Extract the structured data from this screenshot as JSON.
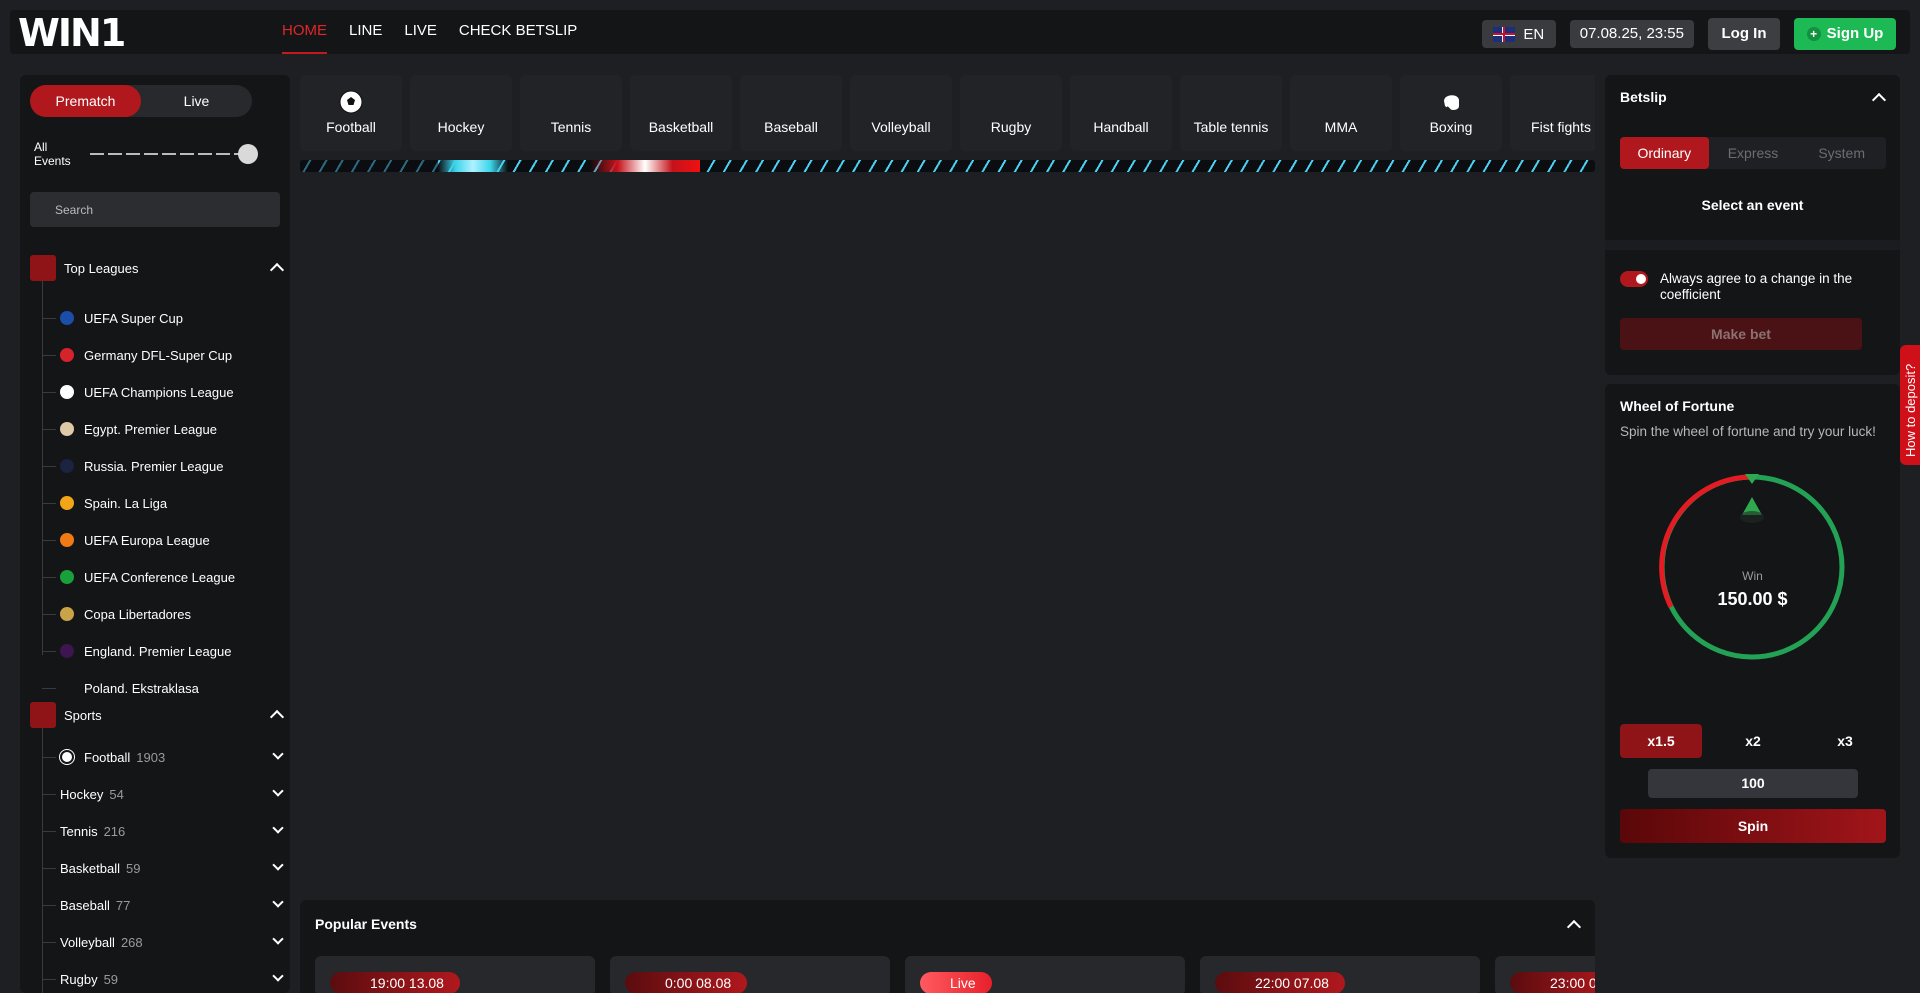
{
  "header": {
    "logo": "WIN1",
    "nav": [
      {
        "label": "HOME",
        "active": true
      },
      {
        "label": "LINE",
        "active": false
      },
      {
        "label": "LIVE",
        "active": false
      },
      {
        "label": "CHECK BETSLIP",
        "active": false
      }
    ],
    "language": "EN",
    "datetime": "07.08.25, 23:55",
    "login_label": "Log In",
    "signup_label": "Sign Up"
  },
  "sidebar": {
    "mode_tabs": [
      "Prematch",
      "Live"
    ],
    "events_label": "All Events",
    "search_placeholder": "Search",
    "top_leagues_title": "Top Leagues",
    "leagues": [
      {
        "name": "UEFA Super Cup",
        "icon": "uefa-super-cup-icon",
        "color": "#1a4ea8"
      },
      {
        "name": "Germany DFL-Super Cup",
        "icon": "dfl-supercup-icon",
        "color": "#d6222a"
      },
      {
        "name": "UEFA Champions League",
        "icon": "champions-league-icon",
        "color": "#ffffff"
      },
      {
        "name": "Egypt. Premier League",
        "icon": "egypt-league-icon",
        "color": "#e0c9a6"
      },
      {
        "name": "Russia. Premier League",
        "icon": "russia-league-icon",
        "color": "#1b2340"
      },
      {
        "name": "Spain. La Liga",
        "icon": "laliga-icon",
        "color": "#f2a516"
      },
      {
        "name": "UEFA Europa League",
        "icon": "europa-league-icon",
        "color": "#f07a14"
      },
      {
        "name": "UEFA Conference League",
        "icon": "conference-league-icon",
        "color": "#18a03a"
      },
      {
        "name": "Copa Libertadores",
        "icon": "libertadores-icon",
        "color": "#c9a347"
      },
      {
        "name": "England. Premier League",
        "icon": "premier-league-icon",
        "color": "#3d1550"
      },
      {
        "name": "Poland. Ekstraklasa",
        "icon": "ekstraklasa-icon",
        "color": "#141517"
      }
    ],
    "sports_title": "Sports",
    "sports": [
      {
        "name": "Football",
        "count": "1903"
      },
      {
        "name": "Hockey",
        "count": "54"
      },
      {
        "name": "Tennis",
        "count": "216"
      },
      {
        "name": "Basketball",
        "count": "59"
      },
      {
        "name": "Baseball",
        "count": "77"
      },
      {
        "name": "Volleyball",
        "count": "268"
      },
      {
        "name": "Rugby",
        "count": "59"
      }
    ]
  },
  "sports_bar": [
    "Football",
    "Hockey",
    "Tennis",
    "Basketball",
    "Baseball",
    "Volleyball",
    "Rugby",
    "Handball",
    "Table tennis",
    "MMA",
    "Boxing",
    "Fist fights"
  ],
  "popular": {
    "title": "Popular Events",
    "cards": [
      "19:00 13.08",
      "0:00 08.08",
      "Live",
      "22:00 07.08",
      "23:00 0"
    ]
  },
  "betslip": {
    "title": "Betslip",
    "tabs": [
      "Ordinary",
      "Express",
      "System"
    ],
    "select_text": "Select an event",
    "agree_text": "Always agree to a change in the coefficient",
    "make_bet_label": "Make bet"
  },
  "wheel": {
    "title": "Wheel of Fortune",
    "subtitle": "Spin the wheel of fortune and try your luck!",
    "win_label": "Win",
    "win_value": "150.00 $",
    "multipliers": [
      "x1.5",
      "x2",
      "x3"
    ],
    "amount": "100",
    "spin_label": "Spin"
  },
  "deposit_tab": "How to deposit?",
  "colors": {
    "accent": "#b0181d",
    "signup": "#1db954",
    "bg": "#1e1f22",
    "panel": "#141517"
  }
}
